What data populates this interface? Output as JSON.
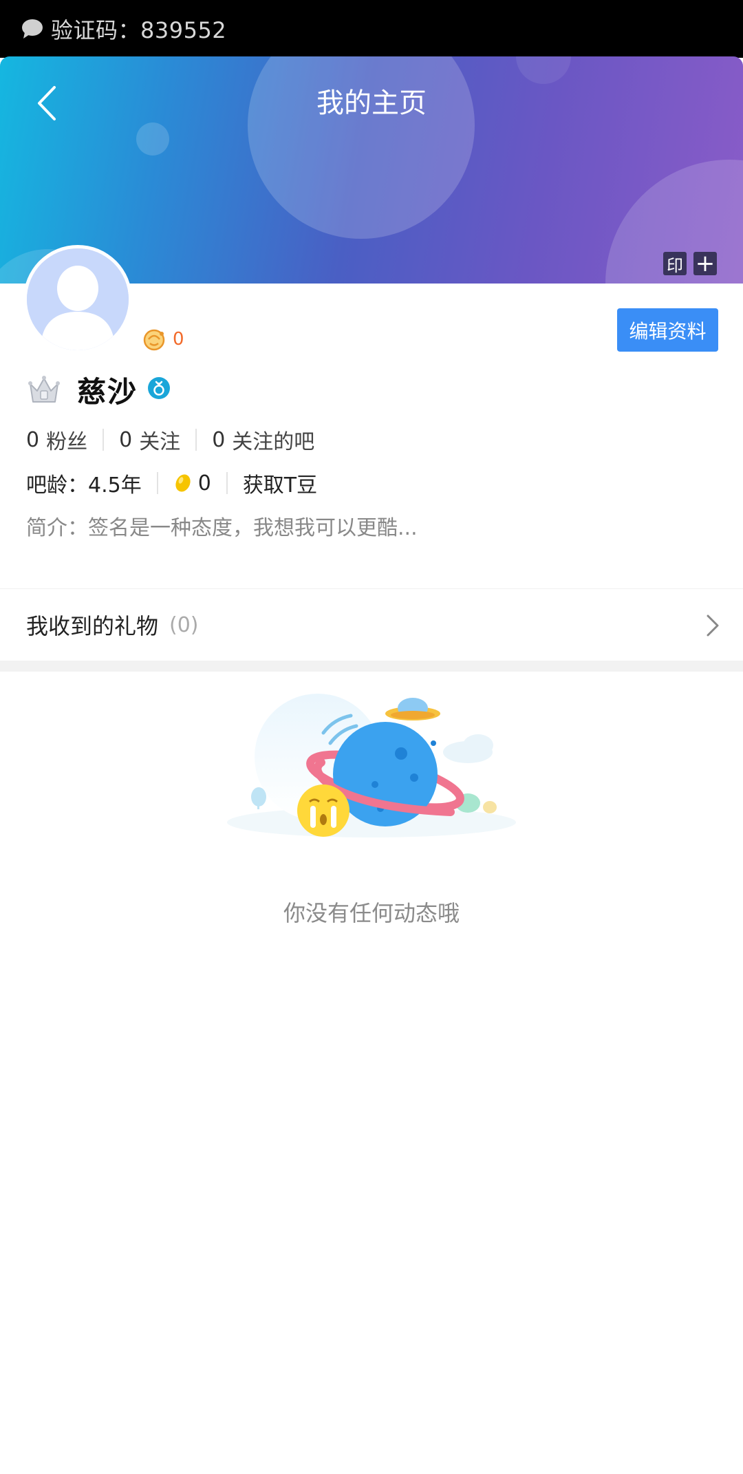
{
  "notification": {
    "text": "验证码：839552",
    "icon": "chat-bubble-icon"
  },
  "header": {
    "title": "我的主页",
    "stamp_label": "印",
    "add_label": "+"
  },
  "profile": {
    "fire_count": "0",
    "edit_button_label": "编辑资料",
    "username": "慈沙",
    "gender_icon": "male-icon",
    "rank_icon": "crown-icon"
  },
  "stats": {
    "fans_num": "0",
    "fans_label": "粉丝",
    "follow_num": "0",
    "follow_label": "关注",
    "bars_num": "0",
    "bars_label": "关注的吧"
  },
  "info": {
    "age_label": "吧龄：4.5年",
    "tdou_count": "0",
    "get_tdou_label": "获取T豆"
  },
  "bio": "简介：签名是一种态度，我想我可以更酷...",
  "gifts": {
    "label": "我收到的礼物",
    "count": "(0)"
  },
  "empty_state": {
    "text": "你没有任何动态哦"
  },
  "colors": {
    "accent": "#3a8ef6",
    "fire": "#f26a2a",
    "gender": "#1aa6d9"
  }
}
